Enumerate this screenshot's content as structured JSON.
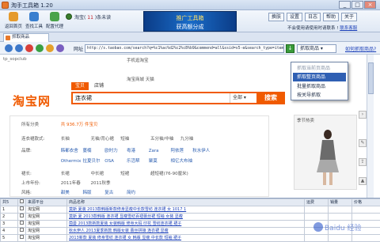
{
  "window": {
    "title": "淘手工具箱 1.20",
    "controls": [
      "_",
      "□",
      "×"
    ]
  },
  "toolbar": {
    "buttons": [
      {
        "label": "返回首页",
        "icon": "home-icon"
      },
      {
        "label": "查找工具",
        "icon": "search-tool-icon"
      },
      {
        "label": "配置代理",
        "icon": "proxy-icon"
      }
    ],
    "user": {
      "name": "淘宝",
      "count": "11",
      "status": "条未读"
    },
    "banner": {
      "line1": "推广工具箱",
      "line2": "获高额分成"
    },
    "right_buttons": [
      "换肤",
      "设置",
      "日志",
      "帮助",
      "关于"
    ],
    "note": "不会使用请使用时请联系 !",
    "note_link": "联系客服"
  },
  "tabs": [
    {
      "label": "抓取商品"
    }
  ],
  "address": {
    "label": "网址",
    "url": "http://s.taobao.com/search?q=%c1%ac%d2%c2%c8%b9&commend=all&ssid=s5-e&search_type=item",
    "capture_label": "抓取商品",
    "help_link": "如何抓取商品?"
  },
  "dropdown": {
    "items": [
      {
        "label": "抓取当前页商品",
        "state": "dim"
      },
      {
        "label": "抓取整页商品",
        "state": "highlight"
      },
      {
        "label": "批量抓取商品",
        "state": "normal"
      },
      {
        "label": "按关导抓取",
        "state": "normal"
      }
    ]
  },
  "taobao": {
    "crumb": "tp_sopclub",
    "top_nav": "手机逛淘宝",
    "logo": "淘宝网",
    "search_tabs": [
      "宝贝",
      "店铺"
    ],
    "query": "连衣裙",
    "category": "全部",
    "search_button": "搜索",
    "right_links": "淘宝商城 天猫",
    "result_prefix": "所有分类",
    "result_count": "共 936.7万 件宝贝",
    "filters": [
      {
        "key": "连衣裙款式:",
        "values": [
          "长袖",
          "无袖/背心裙",
          "短袖",
          "五分袖/中袖",
          "九分袖"
        ]
      },
      {
        "key": "品牌:",
        "values": [
          "韩都衣舍",
          "蔓楠",
          "欧时力",
          "粤港",
          "Zara",
          "阿依莲",
          "秋水伊人"
        ]
      },
      {
        "key": "",
        "values": [
          "Othermix",
          "拉夏贝尔",
          "OSA",
          "乐活帮",
          "聚莫",
          "相亿大布袖"
        ]
      },
      {
        "key": "裙长:",
        "values": [
          "长裙",
          "中长裙",
          "短裙",
          "超短裙(76-90厘米)"
        ]
      },
      {
        "key": "上市年份:",
        "values": [
          "2011年春",
          "2011秋季"
        ]
      },
      {
        "key": "风格:",
        "values": [
          "甜美",
          "韩版",
          "复古",
          "简约"
        ]
      }
    ],
    "panel_title": "季节热卖"
  },
  "grid": {
    "headers": [
      "序号",
      "",
      "来源平台",
      "商品名称",
      "运费",
      "销量",
      "价格"
    ],
    "summary": "共5",
    "rows": [
      {
        "idx": "1",
        "src": "淘宝网",
        "name": "莫斯 夏装 2013款韩版新款修身显瘦中长款雪纺 连衣裙 女 1017 1"
      },
      {
        "idx": "2",
        "src": "淘宝网",
        "name": "莫斯 夏 2013款韩版 连衣裙 显瘦雪纺百褶蕾丝裙 短袖 女装 显瘦"
      },
      {
        "idx": "3",
        "src": "淘宝网",
        "name": "茵曼 2013款新款夏装 女装韩版 修身大码 印花 雪纺连衣裙 裙子"
      },
      {
        "idx": "4",
        "src": "淘宝网",
        "name": "秋水伊人 2013夏季新款 韩版女装 蕾丝拼接 连衣裙 显瘦"
      },
      {
        "idx": "5",
        "src": "淘宝网",
        "name": "2013新款 夏装 修身雪纺 连衣裙 女 韩版 显瘦 中长款 短袖 裙子"
      }
    ]
  },
  "watermark": "Baidu 经验",
  "colors": {
    "taobao_orange": "#f05a00",
    "highlight": "#2f5fb3",
    "link": "#1a3fb8"
  }
}
